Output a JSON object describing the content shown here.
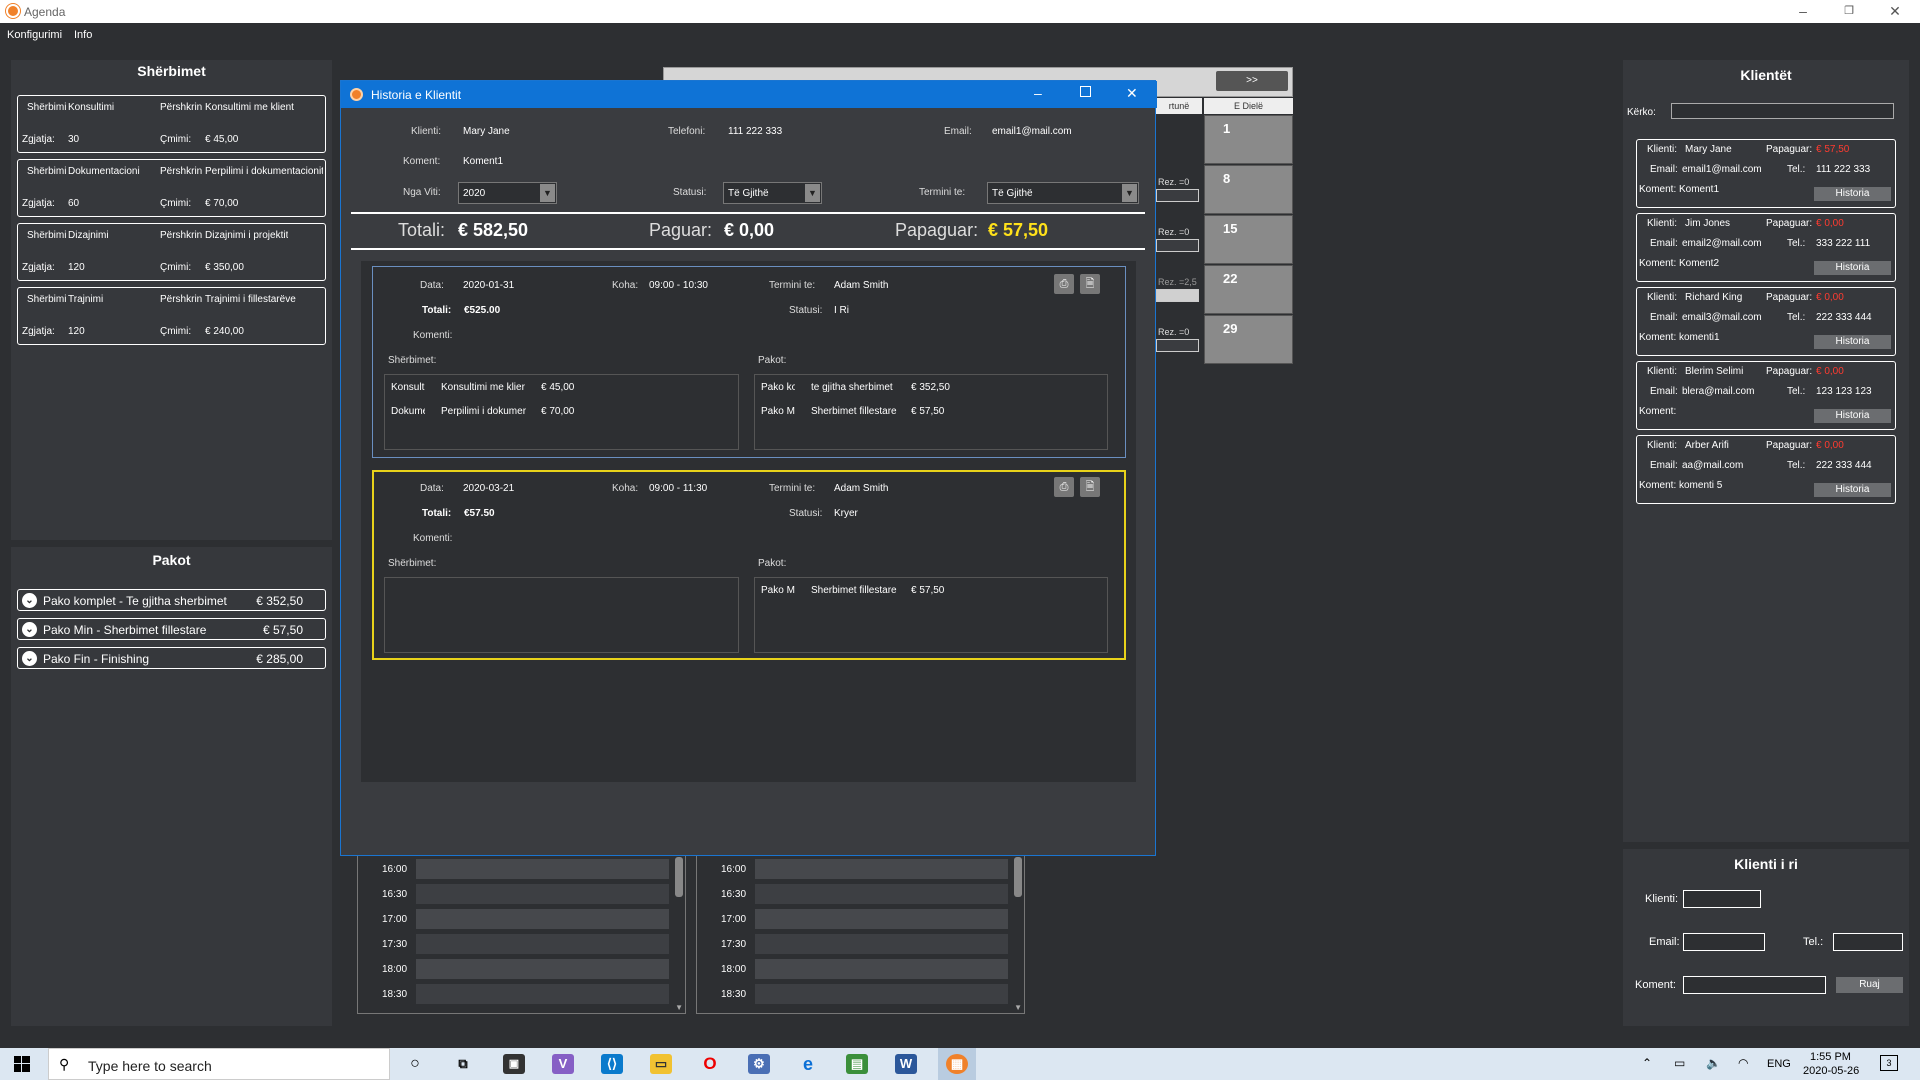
{
  "app": {
    "title": "Agenda"
  },
  "menu": [
    "Konfigurimi",
    "Info"
  ],
  "services": {
    "heading": "Shërbimet",
    "items": [
      {
        "l_sherbimi": "Shërbimi",
        "name": "Konsultimi",
        "l_pershkrimi": "Përshkrin",
        "desc": "Konsultimi me klient",
        "l_zgjatja": "Zgjatja:",
        "duration": "30",
        "l_cmimi": "Çmimi:",
        "price": "€ 45,00"
      },
      {
        "l_sherbimi": "Shërbimi",
        "name": "Dokumentacioni",
        "l_pershkrimi": "Përshkrin",
        "desc": "Perpilimi i dokumentacionit",
        "l_zgjatja": "Zgjatja:",
        "duration": "60",
        "l_cmimi": "Çmimi:",
        "price": "€ 70,00"
      },
      {
        "l_sherbimi": "Shërbimi",
        "name": "Dizajnimi",
        "l_pershkrimi": "Përshkrin",
        "desc": "Dizajnimi i projektit",
        "l_zgjatja": "Zgjatja:",
        "duration": "120",
        "l_cmimi": "Çmimi:",
        "price": "€ 350,00"
      },
      {
        "l_sherbimi": "Shërbimi",
        "name": "Trajnimi",
        "l_pershkrimi": "Përshkrin",
        "desc": "Trajnimi i fillestarëve",
        "l_zgjatja": "Zgjatja:",
        "duration": "120",
        "l_cmimi": "Çmimi:",
        "price": "€ 240,00"
      }
    ]
  },
  "packages": {
    "heading": "Pakot",
    "items": [
      {
        "name": "Pako komplet - Te gjitha sherbimet",
        "price": "€ 352,50"
      },
      {
        "name": "Pako Min - Sherbimet fillestare",
        "price": "€ 57,50"
      },
      {
        "name": "Pako Fin - Finishing",
        "price": "€ 285,00"
      }
    ]
  },
  "calendar": {
    "next_button": ">>",
    "headers": [
      "rtunë",
      "E Dielë"
    ],
    "days": [
      "1",
      "8",
      "15",
      "22",
      "29"
    ],
    "rez": [
      "Rez. =0",
      "Rez. =0",
      "Rez. =2,5",
      "Rez. =0"
    ]
  },
  "schedule": {
    "times": [
      "16:00",
      "16:30",
      "17:00",
      "17:30",
      "18:00",
      "18:30"
    ]
  },
  "clients": {
    "heading": "Klientët",
    "search_label": "Kërko:",
    "l_klienti": "Klienti:",
    "l_papaguar": "Papaguar:",
    "l_email": "Email:",
    "l_tel": "Tel.:",
    "l_koment": "Koment:",
    "history_button": "Historia",
    "items": [
      {
        "name": "Mary Jane",
        "unpaid": "€ 57,50",
        "email": "email1@mail.com",
        "tel": "111 222 333",
        "comment": "Koment1"
      },
      {
        "name": "Jim Jones",
        "unpaid": "€ 0,00",
        "email": "email2@mail.com",
        "tel": "333 222 111",
        "comment": "Koment2"
      },
      {
        "name": "Richard King",
        "unpaid": "€ 0,00",
        "email": "email3@mail.com",
        "tel": "222 333 444",
        "comment": "komenti1"
      },
      {
        "name": "Blerim Selimi",
        "unpaid": "€ 0,00",
        "email": "blera@mail.com",
        "tel": "123 123 123",
        "comment": ""
      },
      {
        "name": "Arber Arifi",
        "unpaid": "€ 0,00",
        "email": "aa@mail.com",
        "tel": "222 333 444",
        "comment": "komenti 5"
      }
    ]
  },
  "new_client": {
    "heading": "Klienti i ri",
    "l_klienti": "Klienti:",
    "l_email": "Email:",
    "l_tel": "Tel.:",
    "l_koment": "Koment:",
    "save_button": "Ruaj"
  },
  "dialog": {
    "title": "Historia e Klientit",
    "l_klienti": "Klienti:",
    "klienti": "Mary Jane",
    "l_telefoni": "Telefoni:",
    "telefoni": "111 222 333",
    "l_email": "Email:",
    "email": "email1@mail.com",
    "l_koment": "Koment:",
    "koment": "Koment1",
    "l_nga_viti": "Nga Viti:",
    "nga_viti": "2020",
    "l_statusi": "Statusi:",
    "statusi": "Të Gjithë",
    "l_termini": "Termini te:",
    "termini": "Të Gjithë",
    "l_totali": "Totali:",
    "totali": "€ 582,50",
    "l_paguar": "Paguar:",
    "paguar": "€ 0,00",
    "l_papaguar": "Papaguar:",
    "papaguar": "€ 57,50",
    "appointments": [
      {
        "l_data": "Data:",
        "data": "2020-01-31",
        "l_koha": "Koha:",
        "koha": "09:00 - 10:30",
        "l_termini": "Termini te:",
        "termini": "Adam Smith",
        "l_totali": "Totali:",
        "totali": "€525.00",
        "l_statusi": "Statusi:",
        "statusi": "I Ri",
        "l_komenti": "Komenti:",
        "l_sherbimet": "Shërbimet:",
        "l_pakot": "Pakot:",
        "services": [
          {
            "c1": "Konsulti",
            "c2": "Konsultimi me klier",
            "c3": "€ 45,00"
          },
          {
            "c1": "Dokume",
            "c2": "Perpilimi i dokumer",
            "c3": "€ 70,00"
          }
        ],
        "packages": [
          {
            "c1": "Pako ko",
            "c2": "te gjitha sherbimet",
            "c3": "€ 352,50"
          },
          {
            "c1": "Pako Mi",
            "c2": "Sherbimet fillestare",
            "c3": "€ 57,50"
          }
        ]
      },
      {
        "l_data": "Data:",
        "data": "2020-03-21",
        "l_koha": "Koha:",
        "koha": "09:00 - 11:30",
        "l_termini": "Termini te:",
        "termini": "Adam Smith",
        "l_totali": "Totali:",
        "totali": "€57.50",
        "l_statusi": "Statusi:",
        "statusi": "Kryer",
        "l_komenti": "Komenti:",
        "l_sherbimet": "Shërbimet:",
        "l_pakot": "Pakot:",
        "packages": [
          {
            "c1": "Pako Mi",
            "c2": "Sherbimet fillestare",
            "c3": "€ 57,50"
          }
        ]
      }
    ]
  },
  "taskbar": {
    "search_placeholder": "Type here to search",
    "lang": "ENG",
    "time": "1:55 PM",
    "date": "2020-05-26",
    "notifications": "3"
  },
  "colors": {
    "accent": "#0f73d6",
    "unpaid": "#ff3b30",
    "highlight": "#ffe11a",
    "selected_border": "#e8d21a"
  }
}
